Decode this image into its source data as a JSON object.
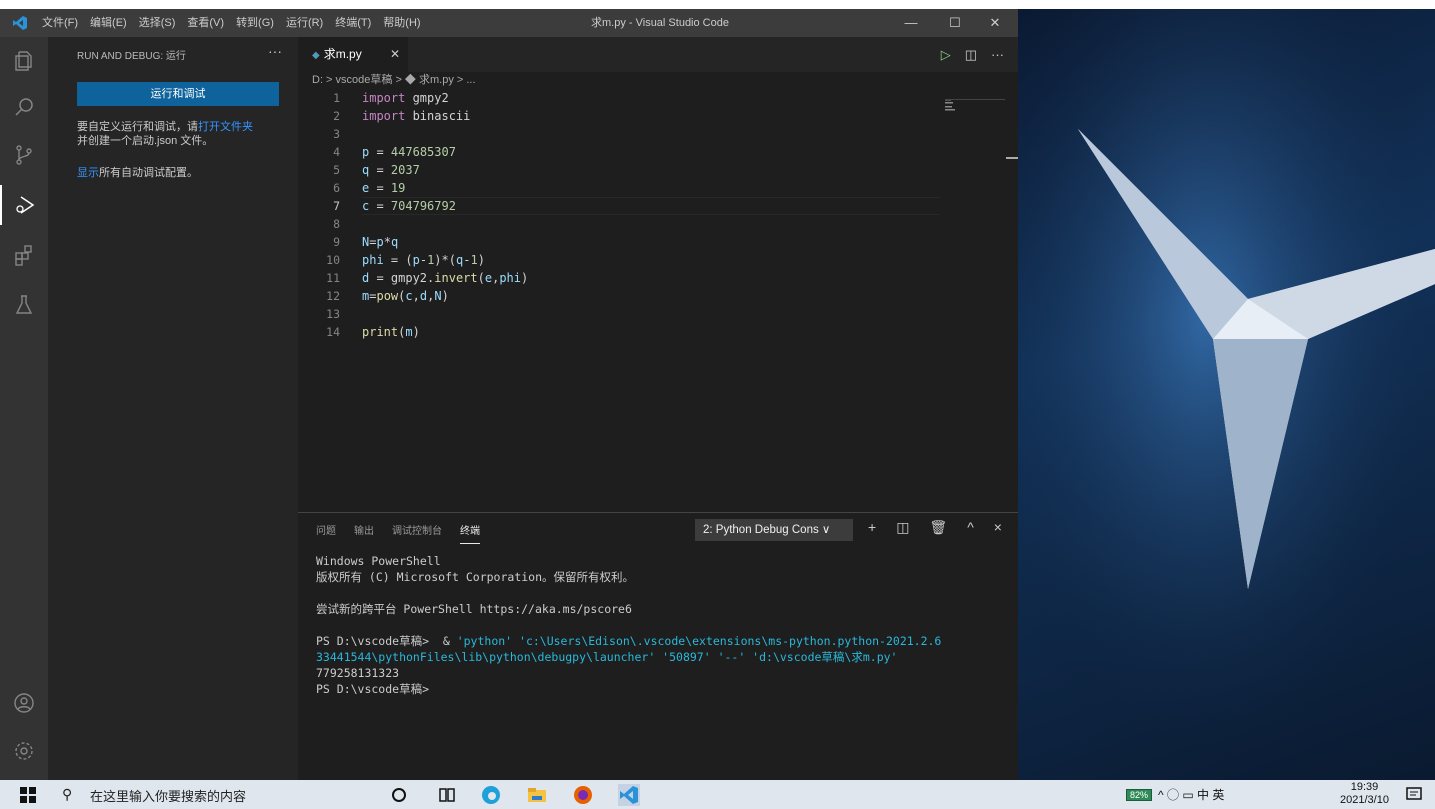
{
  "window": {
    "title": "求m.py - Visual Studio Code",
    "menu": [
      "文件(F)",
      "编辑(E)",
      "选择(S)",
      "查看(V)",
      "转到(G)",
      "运行(R)",
      "终端(T)",
      "帮助(H)"
    ],
    "controls": {
      "minimize": "—",
      "maximize": "☐",
      "close": "✕"
    }
  },
  "activity_bar": [
    "explorer-icon",
    "search-icon",
    "source-control-icon",
    "run-debug-icon",
    "extensions-icon",
    "testing-icon",
    "account-icon",
    "settings-gear-icon"
  ],
  "sidebar": {
    "title": "RUN AND DEBUG: 运行",
    "more": "···",
    "run_button": "运行和调试",
    "text_prefix": "要自定义运行和调试，请",
    "text_link": "打开文件夹",
    "text_suffix": "并创建一个启动.json 文件。",
    "show_link": "显示",
    "show_suffix": "所有自动调试配置。"
  },
  "tab": {
    "label": "求m.py",
    "close": "✕"
  },
  "breadcrumb": "D: > vscode草稿 > ◆ 求m.py > ...",
  "code_lines": [
    {
      "n": "1",
      "text": "import gmpy2"
    },
    {
      "n": "2",
      "text": "import binascii"
    },
    {
      "n": "3",
      "text": ""
    },
    {
      "n": "4",
      "text": "p = 447685307"
    },
    {
      "n": "5",
      "text": "q = 2037"
    },
    {
      "n": "6",
      "text": "e = 19"
    },
    {
      "n": "7",
      "text": "c = 704796792"
    },
    {
      "n": "8",
      "text": ""
    },
    {
      "n": "9",
      "text": "N=p*q"
    },
    {
      "n": "10",
      "text": "phi = (p-1)*(q-1)"
    },
    {
      "n": "11",
      "text": "d = gmpy2.invert(e,phi)"
    },
    {
      "n": "12",
      "text": "m=pow(c,d,N)"
    },
    {
      "n": "13",
      "text": ""
    },
    {
      "n": "14",
      "text": "print(m)"
    }
  ],
  "panel": {
    "tabs": [
      "问题",
      "输出",
      "调试控制台",
      "终端"
    ],
    "active_tab": "终端",
    "terminal_select": "2: Python Debug Cons ∨",
    "actions": [
      "+",
      "◫",
      "🗑",
      "^",
      "×"
    ],
    "terminal_lines": [
      "Windows PowerShell",
      "版权所有 (C) Microsoft Corporation。保留所有权利。",
      "",
      "尝试新的跨平台 PowerShell https://aka.ms/pscore6",
      ""
    ],
    "cmd_prompt": "PS D:\\vscode草稿>  & ",
    "cmd_args_1": "'python' 'c:\\Users\\Edison\\.vscode\\extensions\\ms-python.python-2021.2.6",
    "cmd_args_2": "33441544\\pythonFiles\\lib\\python\\debugpy\\launcher' '50897' '--' 'd:\\vscode草稿\\求m.py'",
    "output": "779258131323",
    "final_prompt": "PS D:\\vscode草稿>"
  },
  "taskbar": {
    "search_placeholder": "在这里输入你要搜索的内容",
    "battery": "82%",
    "tray_text": "^ ◯ ▭ 中 英",
    "time": "19:39",
    "date": "2021/3/10"
  }
}
